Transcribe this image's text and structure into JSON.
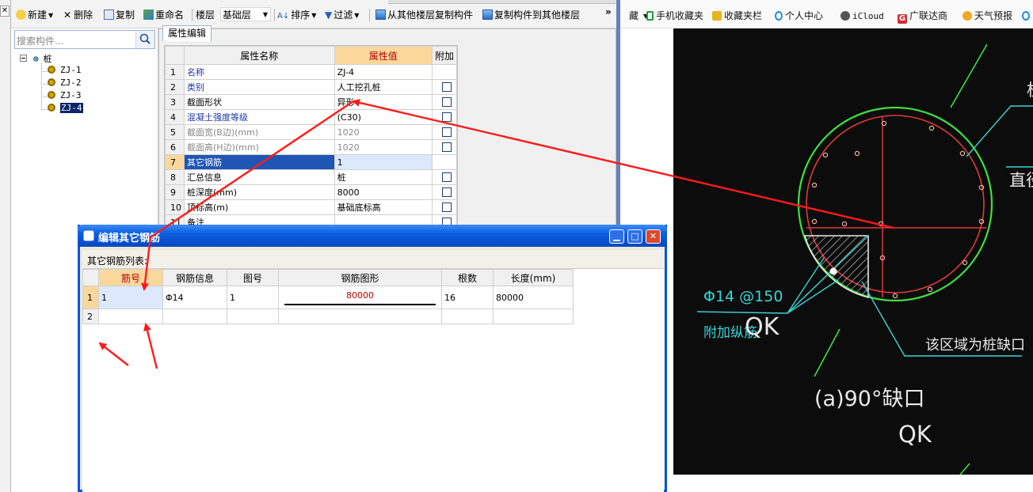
{
  "toolbar": {
    "new_label": "新建",
    "delete_label": "删除",
    "copy_label": "复制",
    "rename_label": "重命名",
    "floor_label": "楼层",
    "floor_value": "基础层",
    "sort_label": "排序",
    "filter_label": "过滤",
    "copy_from_floor_label": "从其他楼层复制构件",
    "copy_to_floor_label": "复制构件到其他楼层",
    "overflow_label": "»"
  },
  "bookmarks": {
    "items": [
      {
        "label": "手机收藏夹",
        "color": "#1f9d3a"
      },
      {
        "label": "收藏夹栏",
        "color": "#e6b422"
      },
      {
        "label": "个人中心",
        "color": "#1e88e5"
      },
      {
        "label": "iCloud",
        "color": "#555555"
      },
      {
        "label": "广联达商",
        "color": "#d32f2f"
      },
      {
        "label": "天气预报",
        "color": "#f5a623"
      }
    ],
    "leading_fragment": "藏"
  },
  "tree": {
    "search_placeholder": "搜索构件...",
    "root_label": "桩",
    "items": [
      "ZJ-1",
      "ZJ-2",
      "ZJ-3",
      "ZJ-4"
    ],
    "selected": "ZJ-4"
  },
  "property_editor": {
    "tab_label": "属性编辑",
    "columns": {
      "name": "属性名称",
      "value": "属性值",
      "extra": "附加"
    },
    "rows": [
      {
        "num": "1",
        "name": "名称",
        "value": "ZJ-4",
        "checkbox": false
      },
      {
        "num": "2",
        "name": "类别",
        "value": "人工挖孔桩",
        "checkbox": true
      },
      {
        "num": "3",
        "name": "截面形状",
        "value": "异形",
        "checkbox": true
      },
      {
        "num": "4",
        "name": "混凝土强度等级",
        "value": "(C30)",
        "checkbox": true
      },
      {
        "num": "5",
        "name": "截面宽(B边)(mm)",
        "value": "1020",
        "checkbox": true
      },
      {
        "num": "6",
        "name": "截面高(H边)(mm)",
        "value": "1020",
        "checkbox": true
      },
      {
        "num": "7",
        "name": "其它钢筋",
        "value": "1",
        "checkbox": false
      },
      {
        "num": "8",
        "name": "汇总信息",
        "value": "桩",
        "checkbox": true
      },
      {
        "num": "9",
        "name": "桩深度(mm)",
        "value": "8000",
        "checkbox": true
      },
      {
        "num": "10",
        "name": "顶标高(m)",
        "value": "基础底标高",
        "checkbox": true
      },
      {
        "num": "11",
        "name": "备注",
        "value": "",
        "checkbox": true
      }
    ]
  },
  "dialog": {
    "title": "编辑其它钢筋",
    "list_label": "其它钢筋列表:",
    "columns": {
      "bar_no": "筋号",
      "bar_info": "钢筋信息",
      "fig_no": "图号",
      "bar_shape": "钢筋图形",
      "count": "根数",
      "length": "长度(mm)"
    },
    "rows": [
      {
        "num": "1",
        "bar_no": "1",
        "bar_info": "Φ14",
        "fig_no": "1",
        "shape_value": "80000",
        "count": "16",
        "length": "80000"
      },
      {
        "num": "2",
        "bar_no": "",
        "bar_info": "",
        "fig_no": "",
        "shape_value": "",
        "count": "",
        "length": ""
      }
    ]
  },
  "photo": {
    "text_rebar": "Φ14 @150",
    "text_extra": "附加纵筋",
    "text_qk1": "QK",
    "text_zone": "该区域为桩缺口",
    "text_caption": "(a)90°缺口",
    "text_qk2": "QK",
    "text_diameter": "直径",
    "text_top": "桩"
  },
  "colors": {
    "accent": "#0a5fdd",
    "annotation_arrow": "#ff1a1a",
    "highlight": "#fbd79c"
  }
}
